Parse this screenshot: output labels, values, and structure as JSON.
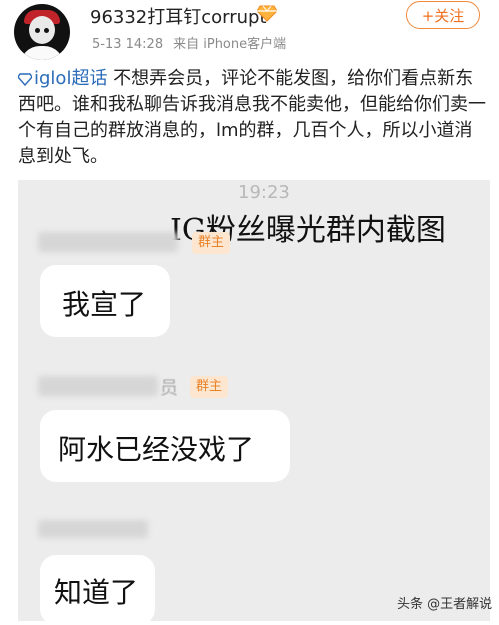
{
  "header": {
    "username": "96332打耳钉corrupt",
    "date": "5-13 14:28",
    "source": "来自 iPhone客户端",
    "follow_label": "+关注"
  },
  "post": {
    "topic": "iglol超话",
    "text": " 不想弄会员，评论不能发图，给你们看点新东西吧。谁和我私聊告诉我消息我不能卖他，但能给你们卖一个有自己的群放消息的，lm的群，几百个人，所以小道消息到处飞。"
  },
  "screenshot": {
    "time": "19:23",
    "caption": "IG粉丝曝光群内截图",
    "messages": [
      {
        "role": "群主",
        "text": "我宣了"
      },
      {
        "role": "群主",
        "member_suffix": "员",
        "text": "阿水已经没戏了"
      },
      {
        "text": "知道了"
      }
    ]
  },
  "watermark": "头条 @王者解说",
  "colors": {
    "accent_orange": "#f07020",
    "topic_blue": "#2b6cb8",
    "badge_bg": "#fde6cf"
  }
}
